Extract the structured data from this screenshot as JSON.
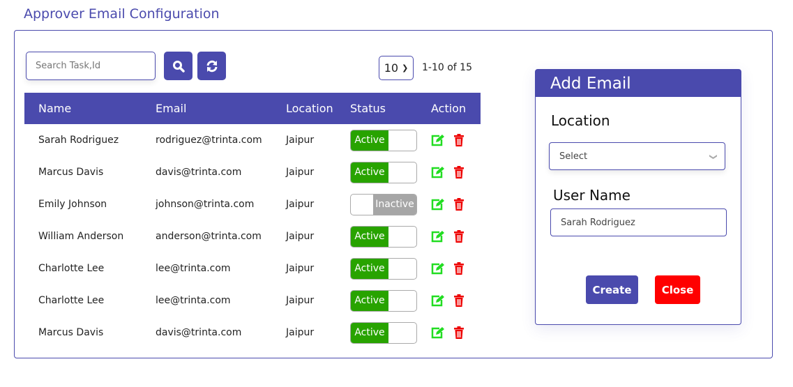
{
  "page": {
    "title": "Approver Email Configuration"
  },
  "toolbar": {
    "search_placeholder": "Search Task,Id",
    "page_size": "10",
    "page_info": "1-10 of 15"
  },
  "table": {
    "headers": [
      "Name",
      "Email",
      "Location",
      "Status",
      "Action"
    ],
    "rows": [
      {
        "name": "Sarah Rodriguez",
        "email": "rodriguez@trinta.com",
        "location": "Jaipur",
        "status": "Active"
      },
      {
        "name": "Marcus Davis",
        "email": "davis@trinta.com",
        "location": "Jaipur",
        "status": "Active"
      },
      {
        "name": "Emily Johnson",
        "email": "johnson@trinta.com",
        "location": "Jaipur",
        "status": "Inactive"
      },
      {
        "name": "William Anderson",
        "email": "anderson@trinta.com",
        "location": "Jaipur",
        "status": "Active"
      },
      {
        "name": "Charlotte Lee",
        "email": "lee@trinta.com",
        "location": "Jaipur",
        "status": "Active"
      },
      {
        "name": "Charlotte Lee",
        "email": "lee@trinta.com",
        "location": "Jaipur",
        "status": "Active"
      },
      {
        "name": "Marcus Davis",
        "email": "davis@trinta.com",
        "location": "Jaipur",
        "status": "Active"
      }
    ]
  },
  "panel": {
    "title": "Add Email",
    "location_label": "Location",
    "location_value": "Select",
    "username_label": "User Name",
    "username_value": "Sarah Rodriguez",
    "create": "Create",
    "close": "Close"
  },
  "colors": {
    "accent": "#4a4aad",
    "active": "#28a300",
    "inactive": "#a6a6a6",
    "edit": "#22dd22",
    "delete": "#ee0000",
    "close": "#ff0000"
  }
}
